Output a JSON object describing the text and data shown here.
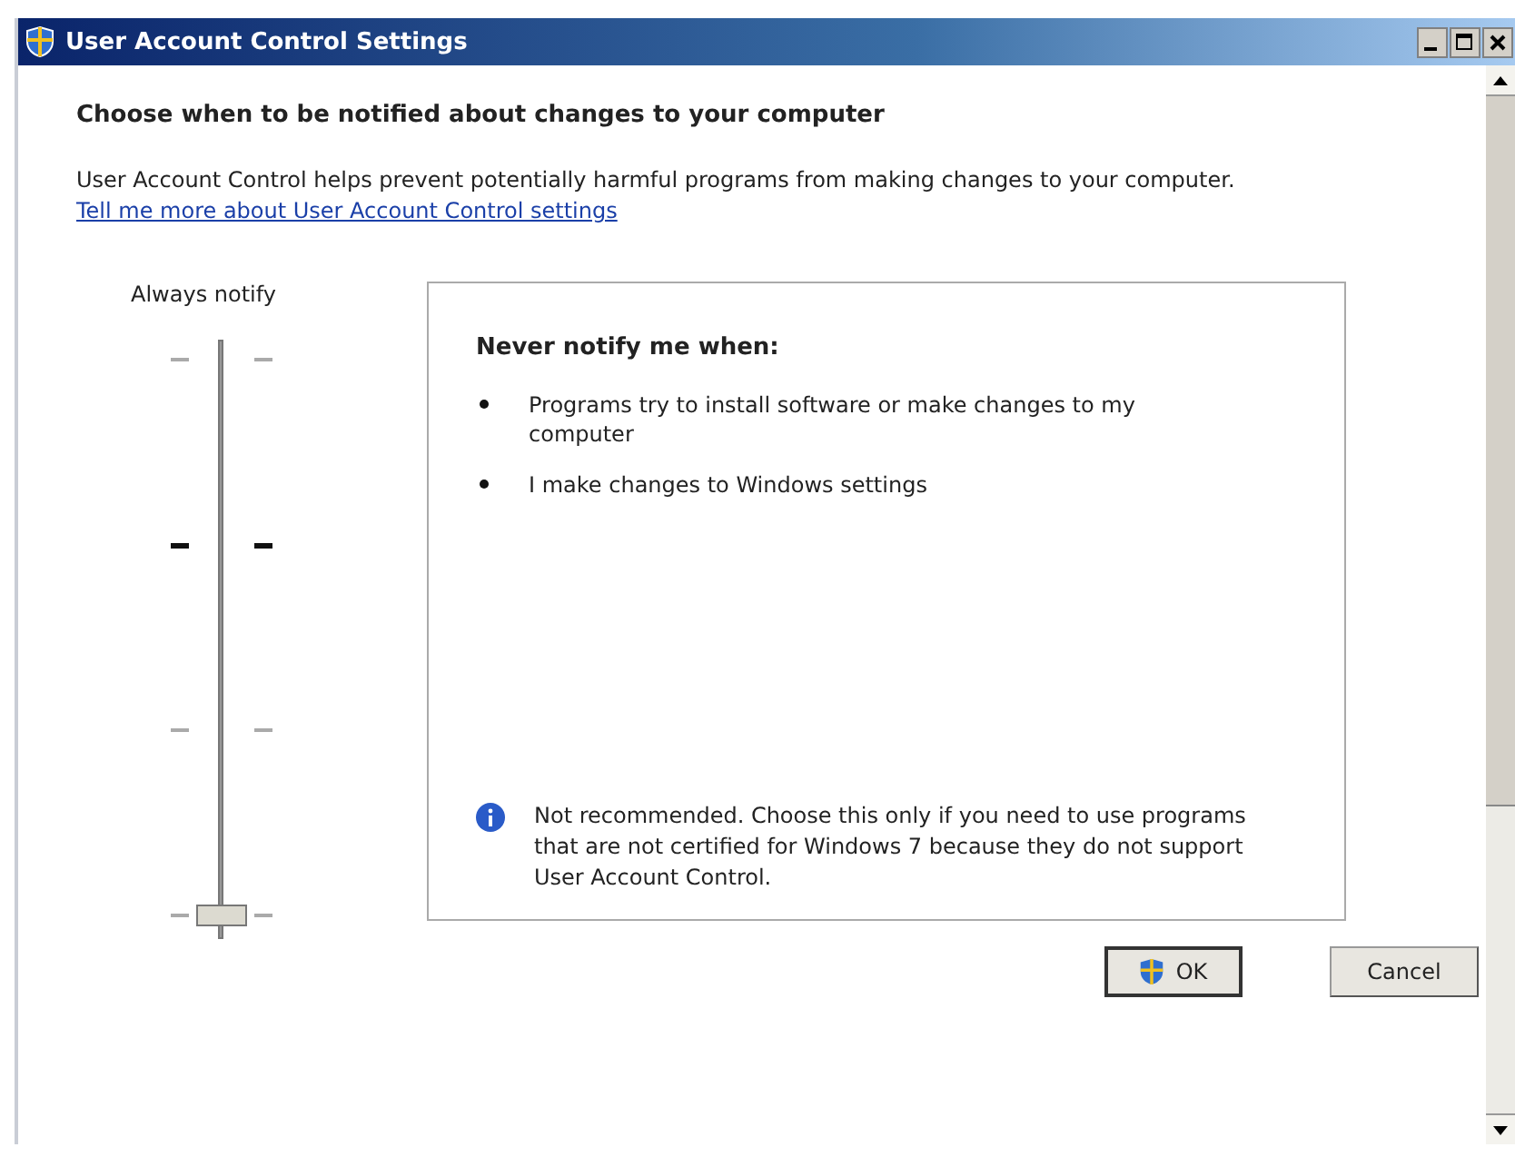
{
  "window": {
    "title": "User Account Control Settings"
  },
  "heading": "Choose when to be notified about changes to your computer",
  "description": "User Account Control helps prevent potentially harmful programs from making changes to your computer.",
  "link": "Tell me more about User Account Control settings",
  "slider": {
    "top_label": "Always notify",
    "level": 0,
    "ticks": [
      {
        "emphasized": false
      },
      {
        "emphasized": true
      },
      {
        "emphasized": false
      },
      {
        "emphasized": false
      }
    ]
  },
  "info_panel": {
    "title": "Never notify me when:",
    "bullets": [
      "Programs try to install software or make changes to my computer",
      "I make changes to Windows settings"
    ],
    "note": "Not recommended. Choose this only if you need to use programs that are not certified for Windows 7 because they do not support User Account Control."
  },
  "buttons": [
    {
      "label": "OK",
      "kind": "shield"
    },
    {
      "label": "Cancel",
      "kind": "plain"
    }
  ]
}
